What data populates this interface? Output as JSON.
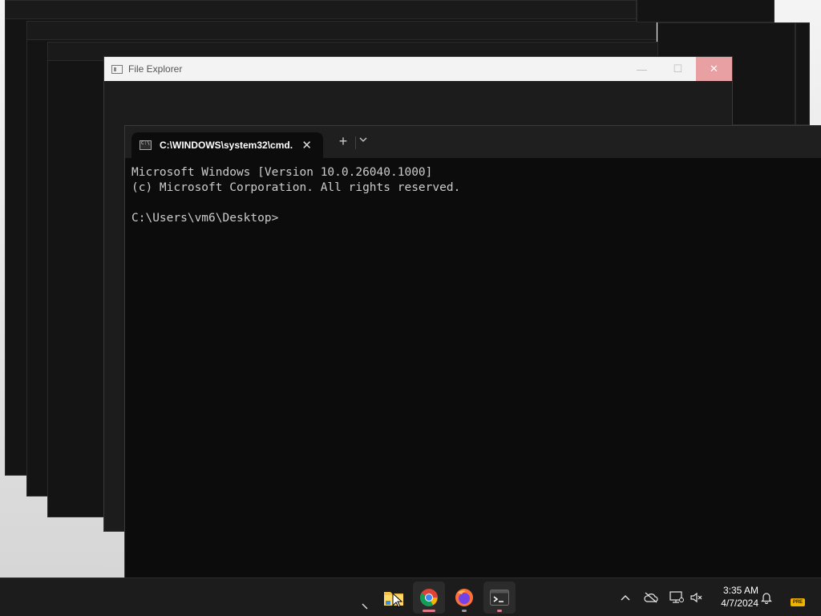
{
  "file_explorer": {
    "title": "File Explorer",
    "controls": {
      "minimize": "—",
      "maximize": "☐",
      "close": "✕"
    }
  },
  "terminal": {
    "tab_title": "C:\\WINDOWS\\system32\\cmd.",
    "tab_close": "✕",
    "new_tab": "+",
    "dropdown": "⌄",
    "lines": [
      "Microsoft Windows [Version 10.0.26040.1000]",
      "(c) Microsoft Corporation. All rights reserved.",
      "",
      "C:\\Users\\vm6\\Desktop>"
    ]
  },
  "taskbar": {
    "apps": [
      {
        "name": "file-explorer",
        "icon": "folder-icon",
        "active": false
      },
      {
        "name": "chrome",
        "icon": "chrome-icon",
        "active": true,
        "indicator_color": "#e07a8a"
      },
      {
        "name": "firefox",
        "icon": "firefox-icon",
        "active": false,
        "indicator_color": "#9a9a9a"
      },
      {
        "name": "terminal",
        "icon": "terminal-icon",
        "active": true,
        "indicator_color": "#e07a8a"
      }
    ],
    "tray": {
      "overflow_icon": "chevron-up-icon",
      "onedrive_icon": "cloud-offline-icon",
      "network_icon": "network-icon",
      "volume_icon": "volume-muted-icon",
      "notification_icon": "bell-icon",
      "badge_label": "PRE"
    },
    "clock": {
      "time": "3:35 AM",
      "date": "4/7/2024"
    }
  },
  "colors": {
    "taskbar_bg": "#1c1c1c",
    "terminal_bg": "#0c0c0c",
    "console_text": "#cccccc",
    "accent_indicator": "#e07a8a"
  }
}
